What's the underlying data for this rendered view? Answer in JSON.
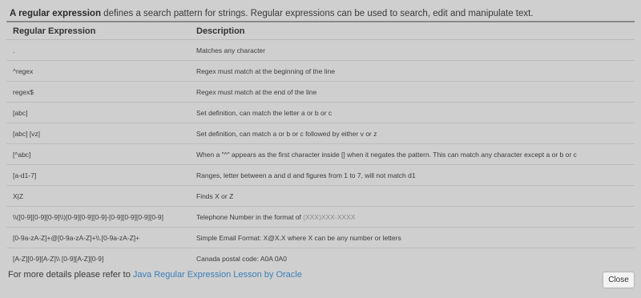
{
  "intro": {
    "bold_term": "A regular expression",
    "rest": " defines a search pattern for strings. Regular expressions can be used to search, edit and manipulate text."
  },
  "table": {
    "headers": {
      "expression": "Regular Expression",
      "description": "Description"
    },
    "rows": [
      {
        "expression": ".",
        "description": "Matches any character"
      },
      {
        "expression": "^regex",
        "description": "Regex must match at the beginning of the line"
      },
      {
        "expression": "regex$",
        "description": "Regex must match at the end of the line"
      },
      {
        "expression": "[abc]",
        "description": "Set definition, can match the letter a or b or c"
      },
      {
        "expression": "[abc] [vz]",
        "description": "Set definition, can match a or b or c followed by either v or z"
      },
      {
        "expression": "[^abc]",
        "description": "When a \"^\" appears as the first character inside [] when it negates the pattern. This can match any character except a or b or c"
      },
      {
        "expression": "[a-d1-7]",
        "description": "Ranges, letter between a and d and figures from 1 to 7, will not match d1"
      },
      {
        "expression": "X|Z",
        "description": "Finds X or Z"
      },
      {
        "expression": "\\\\([0-9][0-9][0-9]\\\\)[0-9][0-9][0-9]-[0-9][0-9][0-9][0-9]",
        "description": "Telephone Number in the format of ",
        "description_hint": "(XXX)XXX-XXXX"
      },
      {
        "expression": "[0-9a-zA-Z]+@[0-9a-zA-Z]+\\\\.[0-9a-zA-Z]+",
        "description": "Simple Email Format: X@X.X where X can be any number or letters"
      },
      {
        "expression": "[A-Z][0-9][A-Z]\\\\ [0-9][A-Z][0-9]",
        "description": "Canada postal code: A0A 0A0"
      }
    ]
  },
  "footer": {
    "text": "For more details please refer to ",
    "link_label": "Java Regular Expression Lesson by Oracle"
  },
  "close_label": "Close"
}
